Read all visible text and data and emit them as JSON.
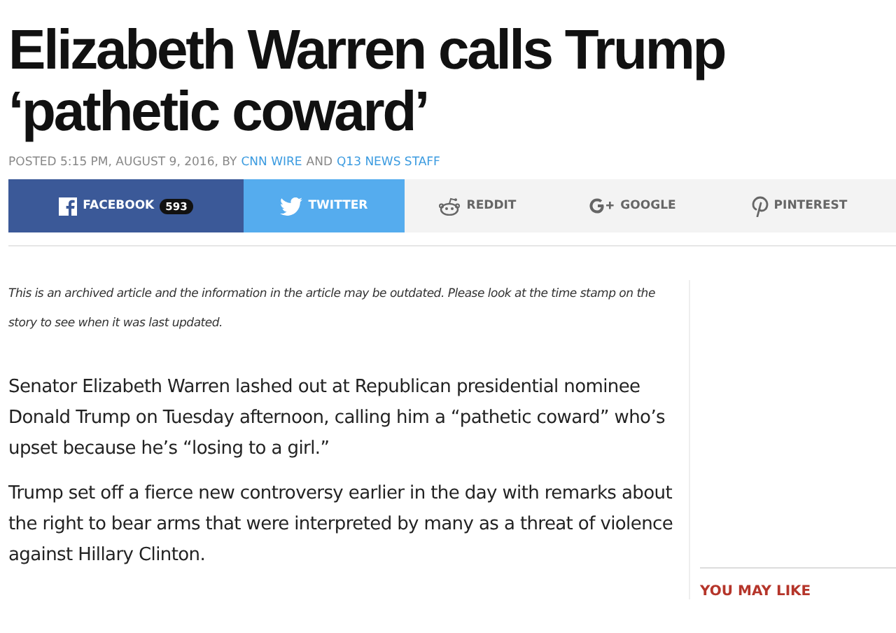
{
  "headline": "Elizabeth Warren calls Trump ‘pathetic coward’",
  "byline": {
    "posted": "POSTED 5:15 PM, AUGUST 9, 2016, BY",
    "authors": [
      "CNN WIRE",
      "Q13 NEWS STAFF"
    ],
    "joiner": "AND"
  },
  "share_buttons": [
    {
      "kind": "facebook",
      "label": "FACEBOOK",
      "count": "593"
    },
    {
      "kind": "twitter",
      "label": "TWITTER"
    },
    {
      "kind": "reddit",
      "label": "REDDIT"
    },
    {
      "kind": "google",
      "label": "GOOGLE"
    },
    {
      "kind": "pinterest",
      "label": "PINTEREST"
    }
  ],
  "archive_note": "This is an archived article and the information in the article may be outdated. Please look at the time stamp on the story to see when it was last updated.",
  "paragraphs": [
    "Senator Elizabeth Warren lashed out at Republican presidential nominee Donald Trump on Tuesday afternoon, calling him a “pathetic coward” who’s upset because he’s “losing to a girl.”",
    "Trump set off a fierce new controversy earlier in the day with remarks about the right to bear arms that were interpreted by many as a threat of violence against Hillary Clinton."
  ],
  "sidebar": {
    "heading": "YOU MAY LIKE"
  }
}
